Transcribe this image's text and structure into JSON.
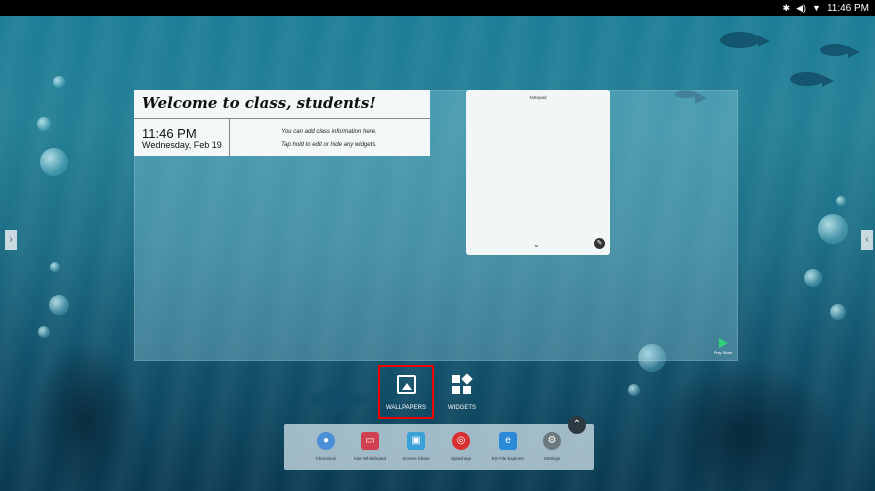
{
  "status_bar": {
    "icons": [
      "bluetooth-icon",
      "volume-icon",
      "wifi-icon"
    ],
    "time": "11:46 PM"
  },
  "welcome_widget": {
    "title": "Welcome to class, students!",
    "time": "11:46 PM",
    "date": "Wednesday, Feb 19",
    "info_line1": "You can add class information here.",
    "info_line2": "Tap hold to edit or hide any widgets."
  },
  "notepad_widget": {
    "title": "Notepad"
  },
  "playstore": {
    "label": "Play Store"
  },
  "bottom_buttons": {
    "wallpapers": "WALLPAPERS",
    "widgets": "WIDGETS"
  },
  "dock": {
    "apps": [
      {
        "label": "Chromium",
        "icon": "chromium-icon",
        "color": "#4a8fd8"
      },
      {
        "label": "Kite Whiteboard",
        "icon": "whiteboard-icon",
        "color": "#d04050"
      },
      {
        "label": "Screen Share",
        "icon": "screen-share-icon",
        "color": "#3aa0d8"
      },
      {
        "label": "Splashtop",
        "icon": "splashtop-icon",
        "color": "#d83030"
      },
      {
        "label": "ES File Explorer",
        "icon": "file-explorer-icon",
        "color": "#2a8ad8"
      },
      {
        "label": "Settings",
        "icon": "settings-icon",
        "color": "#6a7a7f"
      }
    ]
  },
  "colors": {
    "highlight": "#e00000",
    "status_bar": "#000000"
  }
}
